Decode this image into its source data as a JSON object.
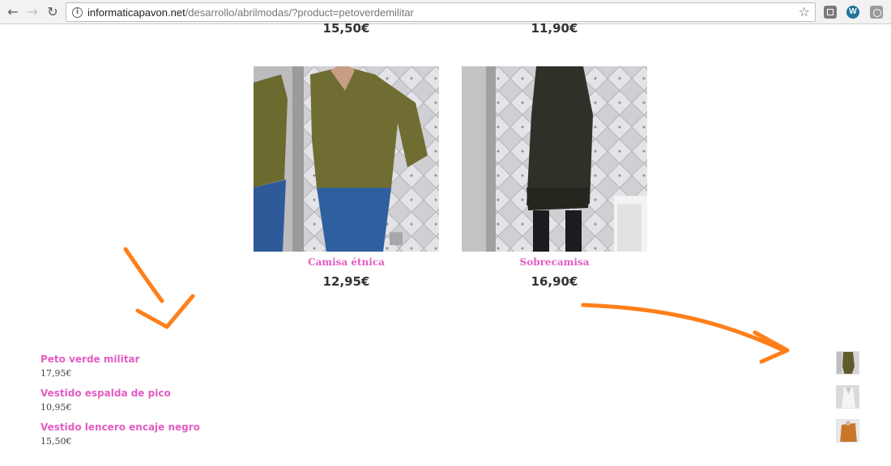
{
  "browser": {
    "url_host": "informaticapavon.net",
    "url_path": "/desarrollo/abrilmodas/?product=petoverdemilitar",
    "icons": [
      "back-icon",
      "forward-icon",
      "reload-icon",
      "info-icon",
      "star-icon"
    ]
  },
  "top_prices": [
    "15,50€",
    "11,90€"
  ],
  "products": [
    {
      "name": "Camisa étnica",
      "price": "12,95€"
    },
    {
      "name": "Sobrecamisa",
      "price": "16,90€"
    }
  ],
  "widget_list": [
    {
      "name": "Peto verde militar",
      "price": "17,95€"
    },
    {
      "name": "Vestido espalda de pico",
      "price": "10,95€"
    },
    {
      "name": "Vestido lencero encaje negro",
      "price": "15,50€"
    }
  ],
  "colors": {
    "link_pink": "#e35cc4",
    "annotation_orange": "#ff7f1a"
  }
}
